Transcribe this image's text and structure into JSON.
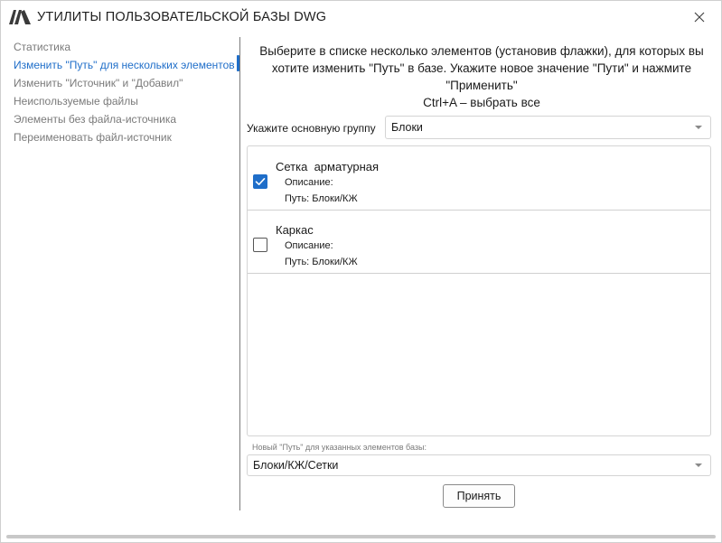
{
  "window": {
    "title": "УТИЛИТЫ ПОЛЬЗОВАТЕЛЬСКОЙ БАЗЫ DWG",
    "close_icon": "close-icon",
    "logo_icon": "app-logo-icon"
  },
  "sidebar": {
    "items": [
      {
        "label": "Статистика",
        "active": false
      },
      {
        "label": "Изменить \"Путь\" для нескольких элементов",
        "active": true
      },
      {
        "label": "Изменить \"Источник\" и \"Добавил\"",
        "active": false
      },
      {
        "label": "Неиспользуемые файлы",
        "active": false
      },
      {
        "label": "Элементы без файла-источника",
        "active": false
      },
      {
        "label": "Переименовать файл-источник",
        "active": false
      }
    ]
  },
  "main": {
    "instructions": [
      "Выберите в списке несколько элементов (установив флажки), для которых вы",
      "хотите изменить \"Путь\" в базе. Укажите новое значение \"Пути\" и нажмите",
      "\"Применить\"",
      "Ctrl+A – выбрать все"
    ],
    "group_label": "Укажите основную группу",
    "group_value": "Блоки",
    "list": [
      {
        "name": "Сетка  арматурная",
        "desc_label": "Описание:",
        "path_label": "Путь: Блоки/КЖ",
        "checked": true
      },
      {
        "name": "Каркас",
        "desc_label": "Описание:",
        "path_label": "Путь: Блоки/КЖ",
        "checked": false
      }
    ],
    "new_path_label": "Новый \"Путь\" для указанных элементов базы:",
    "new_path_value": "Блоки/КЖ/Сетки",
    "apply_label": "Принять"
  },
  "colors": {
    "accent": "#1f6ec9",
    "muted_text": "#7a7a7a",
    "border": "#d4d4d4"
  }
}
